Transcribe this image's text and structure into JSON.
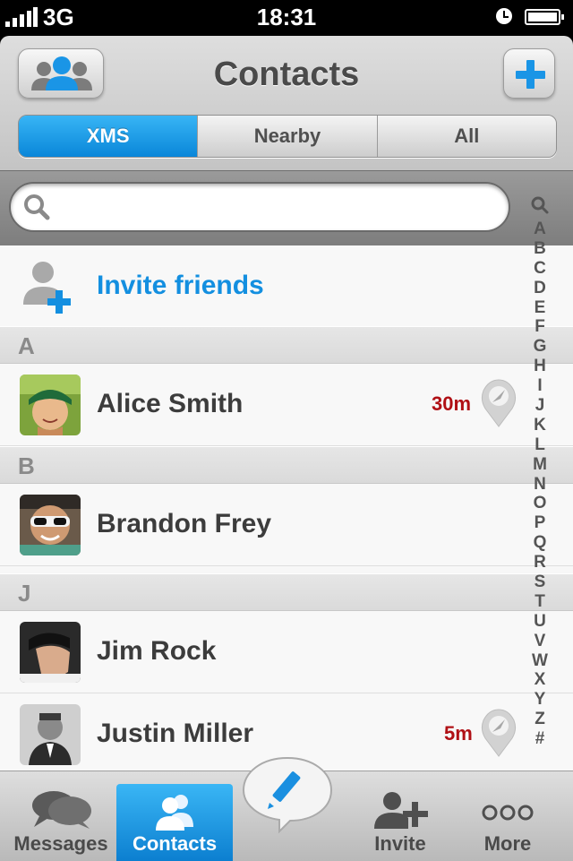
{
  "status_bar": {
    "carrier": "3G",
    "time": "18:31"
  },
  "header": {
    "title": "Contacts"
  },
  "segments": [
    {
      "label": "XMS",
      "active": true
    },
    {
      "label": "Nearby",
      "active": false
    },
    {
      "label": "All",
      "active": false
    }
  ],
  "search": {
    "placeholder": ""
  },
  "invite": {
    "label": "Invite friends"
  },
  "sections": [
    {
      "letter": "A",
      "contacts": [
        {
          "name": "Alice Smith",
          "distance": "30m"
        }
      ]
    },
    {
      "letter": "B",
      "contacts": [
        {
          "name": "Brandon Frey",
          "distance": ""
        }
      ]
    },
    {
      "letter": "J",
      "contacts": [
        {
          "name": "Jim Rock",
          "distance": ""
        },
        {
          "name": "Justin Miller",
          "distance": "5m"
        }
      ]
    }
  ],
  "index_letters": [
    "A",
    "B",
    "C",
    "D",
    "E",
    "F",
    "G",
    "H",
    "I",
    "J",
    "K",
    "L",
    "M",
    "N",
    "O",
    "P",
    "Q",
    "R",
    "S",
    "T",
    "U",
    "V",
    "W",
    "X",
    "Y",
    "Z",
    "#"
  ],
  "tabs": [
    {
      "label": "Messages",
      "icon": "messages-icon",
      "active": false
    },
    {
      "label": "Contacts",
      "icon": "contacts-icon",
      "active": true
    },
    {
      "label": "Invite",
      "icon": "add-person-icon",
      "active": false
    },
    {
      "label": "More",
      "icon": "more-icon",
      "active": false
    }
  ],
  "colors": {
    "accent": "#138fe0",
    "distance": "#b01015"
  }
}
